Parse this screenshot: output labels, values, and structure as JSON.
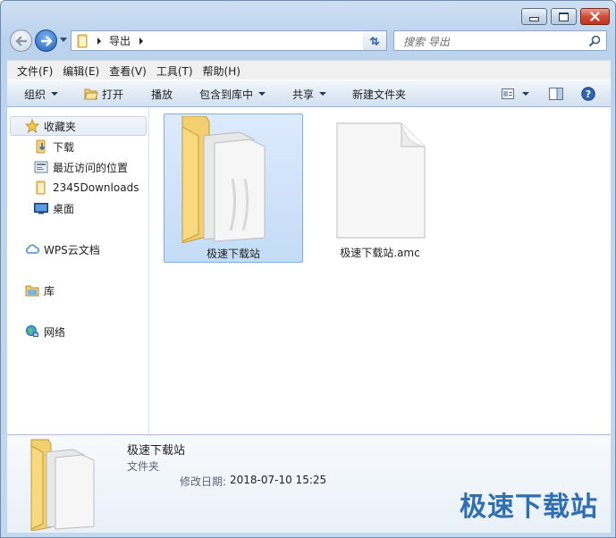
{
  "window": {
    "caption_buttons": [
      "minimize",
      "maximize",
      "close"
    ]
  },
  "address": {
    "path": [
      "导出"
    ],
    "search_placeholder": "搜索 导出"
  },
  "menu": [
    "文件(F)",
    "编辑(E)",
    "查看(V)",
    "工具(T)",
    "帮助(H)"
  ],
  "commands": {
    "organize": "组织",
    "open": "打开",
    "play": "播放",
    "include_library": "包含到库中",
    "share": "共享",
    "new_folder": "新建文件夹"
  },
  "nav": {
    "favorites": "收藏夹",
    "favorites_items": [
      "下载",
      "最近访问的位置",
      "2345Downloads",
      "桌面"
    ],
    "wps_cloud": "WPS云文档",
    "libraries": "库",
    "network": "网络"
  },
  "files": [
    {
      "name": "极速下载站",
      "type": "folder",
      "selected": true
    },
    {
      "name": "极速下载站.amc",
      "type": "file",
      "selected": false
    }
  ],
  "details": {
    "name": "极速下载站",
    "type": "文件夹",
    "modified_label": "修改日期:",
    "modified_value": "2018-07-10 15:25"
  },
  "watermark": "极速下载站",
  "colors": {
    "accent": "#3a78c9",
    "selection": "#cde3fa",
    "close_button": "#c8402a"
  }
}
